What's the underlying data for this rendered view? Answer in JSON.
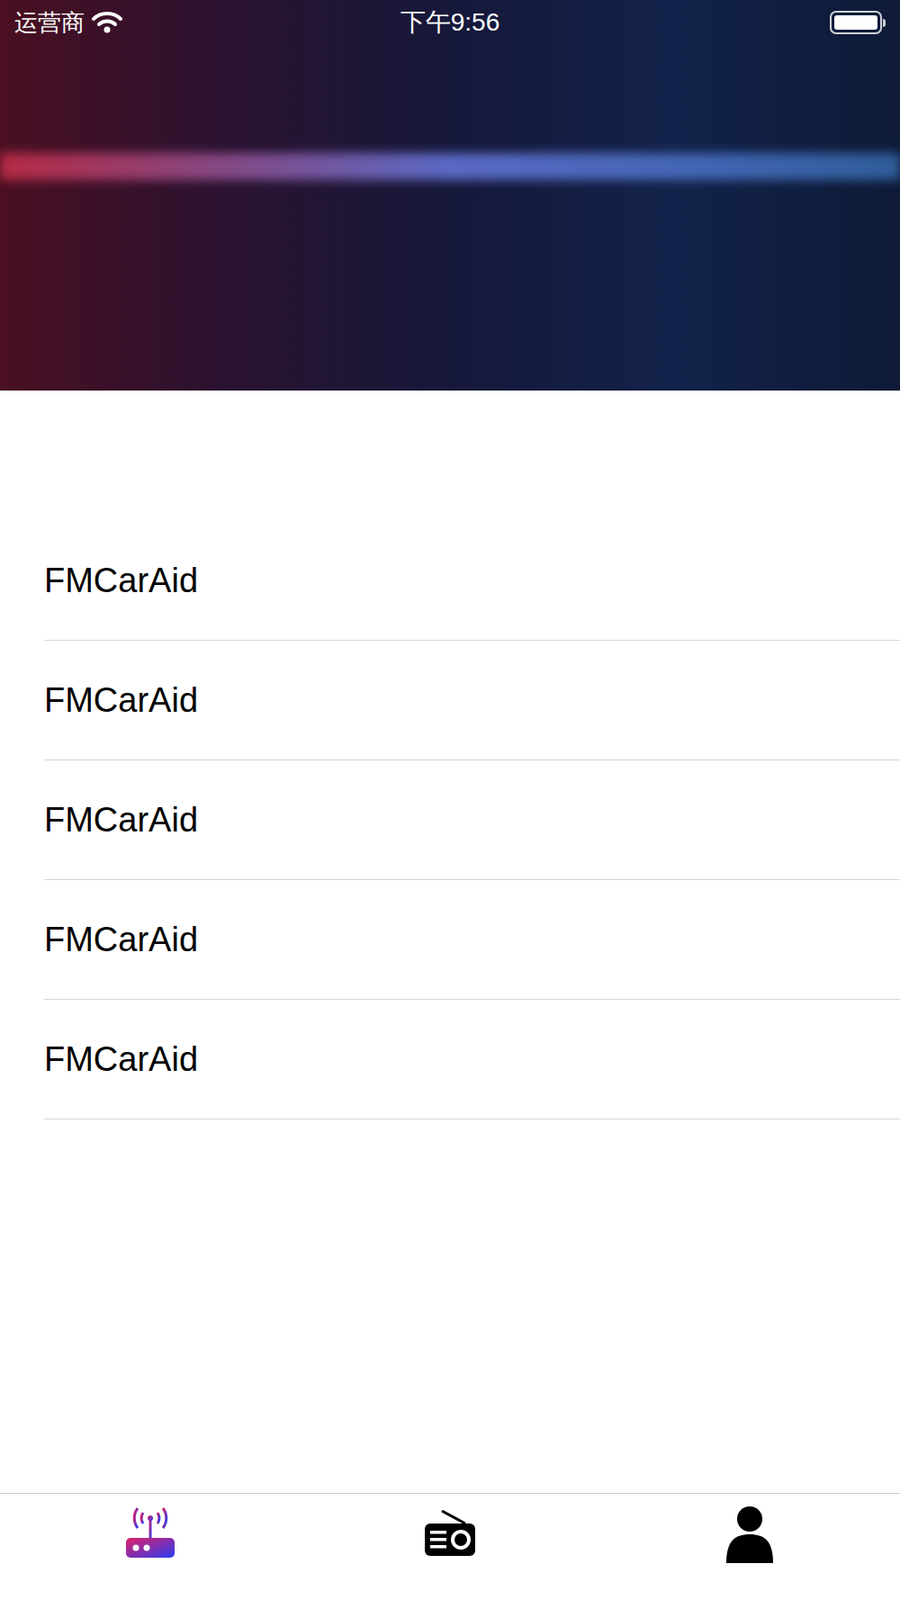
{
  "status_bar": {
    "carrier": "运营商",
    "time": "下午9:56",
    "wifi": true,
    "battery": {
      "level": 1
    }
  },
  "list": {
    "items": [
      {
        "title": "FMCarAid"
      },
      {
        "title": "FMCarAid"
      },
      {
        "title": "FMCarAid"
      },
      {
        "title": "FMCarAid"
      },
      {
        "title": "FMCarAid"
      }
    ]
  },
  "tab_bar": {
    "tabs": [
      {
        "kind": "router",
        "selected": true
      },
      {
        "kind": "radio",
        "selected": false
      },
      {
        "kind": "profile",
        "selected": false
      }
    ]
  }
}
